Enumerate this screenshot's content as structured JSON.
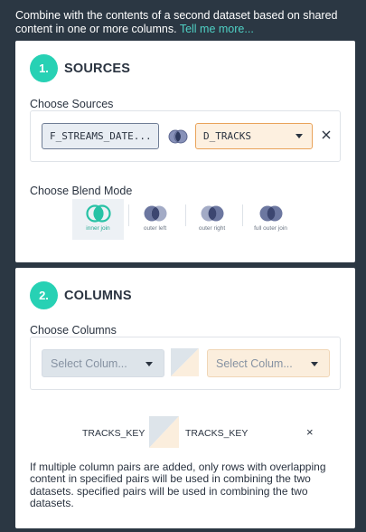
{
  "intro": {
    "text": "Combine with the contents of a second dataset based on shared content in one or more columns.",
    "link": "Tell me more..."
  },
  "colors": {
    "accent": "#27d1b4",
    "link": "#4fd1c5",
    "background": "#2b3743"
  },
  "sources": {
    "step_number": "1.",
    "title": "SOURCES",
    "choose_label": "Choose Sources",
    "source_name": "F_STREAMS_DATE...",
    "target_name": "D_TRACKS",
    "remove_icon": "close-icon",
    "blend_label": "Choose Blend Mode",
    "blend_modes": [
      {
        "label": "inner join",
        "icon": "inner-join-icon",
        "selected": true
      },
      {
        "label": "outer left",
        "icon": "outer-left-icon",
        "selected": false
      },
      {
        "label": "outer right",
        "icon": "outer-right-icon",
        "selected": false
      },
      {
        "label": "full outer join",
        "icon": "full-outer-join-icon",
        "selected": false
      }
    ]
  },
  "columns": {
    "step_number": "2.",
    "title": "COLUMNS",
    "choose_label": "Choose Columns",
    "left_placeholder": "Select Colum...",
    "right_placeholder": "Select Colum...",
    "pair": {
      "left": "TRACKS_KEY",
      "right": "TRACKS_KEY",
      "remove": "×"
    },
    "note": "If multiple column pairs are added, only rows with overlapping content in specified pairs will be used in combining the two datasets. specified pairs will be used in combining the two datasets."
  }
}
